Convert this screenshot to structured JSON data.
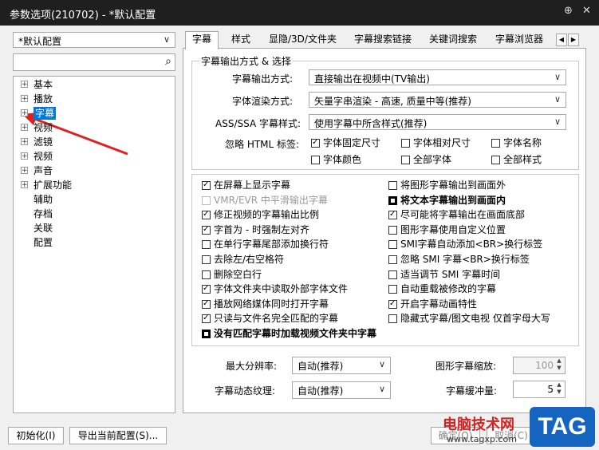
{
  "window": {
    "title": "参数选项(210702) - *默认配置",
    "pin_icon": "pin-icon",
    "close_icon": "close-icon"
  },
  "profile_combo": {
    "value": "*默认配置"
  },
  "search": {
    "value": "",
    "icon": "search-icon"
  },
  "tree": {
    "items": [
      {
        "label": "基本",
        "expandable": true
      },
      {
        "label": "播放",
        "expandable": true
      },
      {
        "label": "字幕",
        "expandable": true,
        "selected": true
      },
      {
        "label": "视频",
        "expandable": true
      },
      {
        "label": "滤镜",
        "expandable": true
      },
      {
        "label": "视频",
        "expandable": true
      },
      {
        "label": "声音",
        "expandable": true
      },
      {
        "label": "扩展功能",
        "expandable": true
      },
      {
        "label": "辅助",
        "expandable": false
      },
      {
        "label": "存档",
        "expandable": false
      },
      {
        "label": "关联",
        "expandable": false
      },
      {
        "label": "配置",
        "expandable": false
      }
    ]
  },
  "tabs": [
    {
      "label": "字幕",
      "active": true
    },
    {
      "label": "样式"
    },
    {
      "label": "显隐/3D/文件夹"
    },
    {
      "label": "字幕搜索链接"
    },
    {
      "label": "关键词搜索"
    },
    {
      "label": "字幕浏览器"
    }
  ],
  "tab_scroll": {
    "left": "◀",
    "right": "▶"
  },
  "output_group": {
    "title": "字幕输出方式 & 选择",
    "output_mode": {
      "label": "字幕输出方式:",
      "value": "直接输出在视频中(TV输出)"
    },
    "render_mode": {
      "label": "字体渲染方式:",
      "value": "矢量字串渲染 - 高速, 质量中等(推荐)"
    },
    "ass_style": {
      "label": "ASS/SSA 字幕样式:",
      "value": "使用字幕中所含样式(推荐)"
    },
    "ignore_html": {
      "label": "忽略 HTML 标签:",
      "options": [
        {
          "label": "字体固定尺寸",
          "checked": true
        },
        {
          "label": "字体相对尺寸",
          "checked": false
        },
        {
          "label": "字体名称",
          "checked": false
        },
        {
          "label": "字体颜色",
          "checked": false
        },
        {
          "label": "全部字体",
          "checked": false
        },
        {
          "label": "全部样式",
          "checked": false
        }
      ]
    }
  },
  "options_left": [
    {
      "label": "在屏幕上显示字幕",
      "state": "checked"
    },
    {
      "label": "VMR/EVR 中平滑输出字幕",
      "state": "disabled"
    },
    {
      "label": "修正视频的字幕输出比例",
      "state": "checked"
    },
    {
      "label": "字首为 - 时强制左对齐",
      "state": "checked"
    },
    {
      "label": "在单行字幕尾部添加换行符",
      "state": "unchecked"
    },
    {
      "label": "去除左/右空格符",
      "state": "unchecked"
    },
    {
      "label": "删除空白行",
      "state": "unchecked"
    },
    {
      "label": "字体文件夹中读取外部字体文件",
      "state": "checked"
    },
    {
      "label": "播放网络媒体同时打开字幕",
      "state": "checked"
    },
    {
      "label": "只读与文件名完全匹配的字幕",
      "state": "checked"
    },
    {
      "label": "没有匹配字幕时加载视频文件夹中字幕",
      "state": "filled"
    }
  ],
  "options_right": [
    {
      "label": "将图形字幕输出到画面外",
      "state": "unchecked"
    },
    {
      "label": "将文本字幕输出到画面内",
      "state": "filled"
    },
    {
      "label": "尽可能将字幕输出在画面底部",
      "state": "checked"
    },
    {
      "label": "图形字幕使用自定义位置",
      "state": "unchecked"
    },
    {
      "label": "SMI字幕自动添加<BR>换行标签",
      "state": "unchecked"
    },
    {
      "label": "忽略 SMI 字幕<BR>换行标签",
      "state": "unchecked"
    },
    {
      "label": "适当调节 SMI 字幕时间",
      "state": "unchecked"
    },
    {
      "label": "自动重载被修改的字幕",
      "state": "unchecked"
    },
    {
      "label": "开启字幕动画特性",
      "state": "checked"
    },
    {
      "label": "隐藏式字幕/图文电视 仅首字母大写",
      "state": "unchecked"
    }
  ],
  "bottom_settings": {
    "max_resolution": {
      "label": "最大分辨率:",
      "value": "自动(推荐)"
    },
    "dynamic_texture": {
      "label": "字幕动态纹理:",
      "value": "自动(推荐)"
    },
    "graphic_scale": {
      "label": "图形字幕缩放:",
      "value": "100"
    },
    "buffer_size": {
      "label": "字幕缓冲量:",
      "value": "5"
    }
  },
  "footer": {
    "init_button": "初始化(I)",
    "export_button": "导出当前配置(S)...",
    "ok_button": "确定(O)",
    "cancel_button": "取消(C)"
  },
  "watermark": {
    "site_name": "电脑技术网",
    "site_url": "www.tagxp.com",
    "logo_text": "TAG"
  },
  "colors": {
    "selection": "#0078d7",
    "annotation_arrow": "#e02020",
    "titlebar": "#1f1f1f",
    "logo_bg": "#1565c0"
  }
}
